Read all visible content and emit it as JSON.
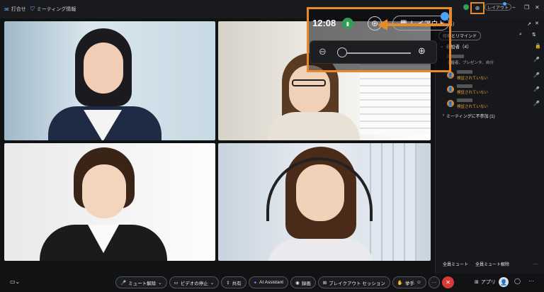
{
  "topbar": {
    "item1": "打合せ",
    "item2": "ミーティング情報",
    "layout_label": "レイアウト"
  },
  "zoom": {
    "time": "12:08",
    "layout_label": "レイアウト"
  },
  "sidebar": {
    "title": "者（4）",
    "remind_btn": "待機とリマインド",
    "participants_header": "参加者（4）",
    "host_line": "主催者、プレゼンタ、自分",
    "status": "検証されていない",
    "status2": "検証されていない",
    "status3": "検証されていない",
    "not_joined": "ミーティングに不参加 (1)",
    "mute_all": "全員ミュート",
    "unmute_all": "全員ミュート解除",
    "more": "···"
  },
  "controls": {
    "unmute": "ミュート解除",
    "stop_video": "ビデオの停止",
    "share": "共有",
    "ai": "AI Assistant",
    "record": "録画",
    "breakout": "ブレイクアウト セッション",
    "raise": "挙手",
    "apps": "アプリ"
  }
}
